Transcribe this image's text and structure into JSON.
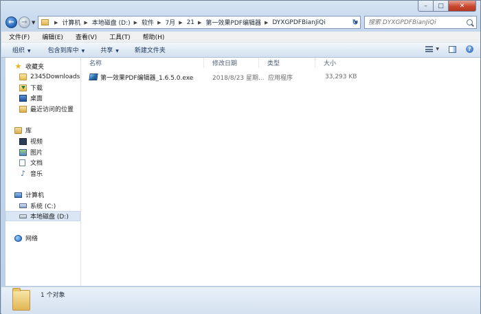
{
  "window": {
    "caption": {
      "minimize": "–",
      "maximize": "□",
      "close": "✕"
    }
  },
  "address": {
    "crumbs": [
      "计算机",
      "本地磁盘 (D:)",
      "软件",
      "7月",
      "21",
      "第一效果PDF编辑器",
      "DYXGPDFBianJiQi"
    ]
  },
  "search": {
    "placeholder": "搜索 DYXGPDFBianJiQi"
  },
  "menu": [
    "文件(F)",
    "编辑(E)",
    "查看(V)",
    "工具(T)",
    "帮助(H)"
  ],
  "commands": {
    "organize": "组织",
    "include_library": "包含到库中",
    "share": "共享",
    "new_folder": "新建文件夹"
  },
  "nav": {
    "favorites": "收藏夹",
    "downloads_2345": "2345Downloads",
    "downloads": "下载",
    "desktop": "桌面",
    "recent": "最近访问的位置",
    "libraries": "库",
    "videos": "视频",
    "pictures": "图片",
    "documents": "文档",
    "music": "音乐",
    "computer": "计算机",
    "drive_c": "系统 (C:)",
    "drive_d": "本地磁盘 (D:)",
    "network": "网络"
  },
  "columns": {
    "name": "名称",
    "date": "修改日期",
    "type": "类型",
    "size": "大小"
  },
  "files": [
    {
      "name": "第一效果PDF编辑器_1.6.5.0.exe",
      "date": "2018/8/23 星期...",
      "type": "应用程序",
      "size": "33,293 KB"
    }
  ],
  "status": {
    "count": "1 个对象"
  }
}
